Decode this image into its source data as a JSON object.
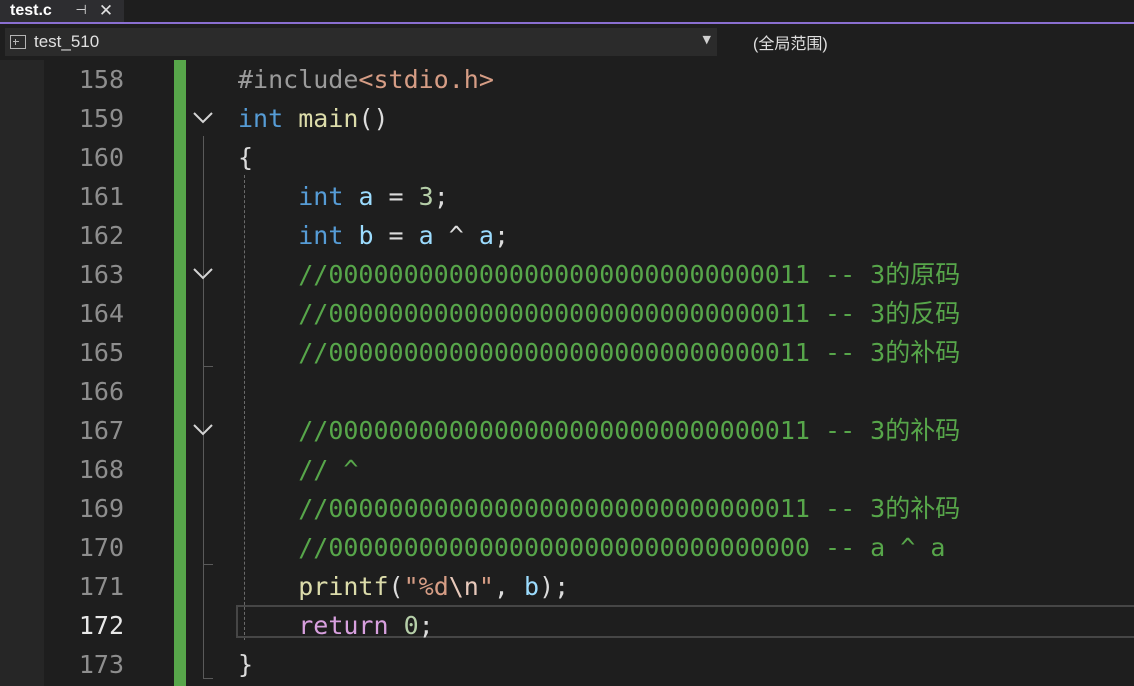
{
  "tab": {
    "title": "test.c",
    "pin_icon": "pin-icon",
    "close_icon": "close-icon"
  },
  "navbar": {
    "project": "test_510",
    "scope": "(全局范围)"
  },
  "colors": {
    "accent": "#8a6fd1",
    "change_bar": "#57a64a",
    "keyword": "#569cd6",
    "comment": "#57a64a",
    "function": "#dcdcaa",
    "variable": "#9cdcfe",
    "number": "#b5cea8",
    "string": "#d69d85",
    "return_kw": "#d8a0df"
  },
  "editor": {
    "current_line": "172",
    "lines": [
      {
        "num": "158",
        "tokens": [
          {
            "t": "pre",
            "v": "#include"
          },
          {
            "t": "inc",
            "v": "<stdio.h>"
          }
        ]
      },
      {
        "num": "159",
        "tokens": [
          {
            "t": "kw",
            "v": "int"
          },
          {
            "t": "op",
            "v": " "
          },
          {
            "t": "fn",
            "v": "main"
          },
          {
            "t": "op",
            "v": "()"
          }
        ]
      },
      {
        "num": "160",
        "tokens": [
          {
            "t": "op",
            "v": "{"
          }
        ]
      },
      {
        "num": "161",
        "tokens": [
          {
            "t": "op",
            "v": "    "
          },
          {
            "t": "kw",
            "v": "int"
          },
          {
            "t": "op",
            "v": " "
          },
          {
            "t": "var",
            "v": "a"
          },
          {
            "t": "op",
            "v": " = "
          },
          {
            "t": "num",
            "v": "3"
          },
          {
            "t": "op",
            "v": ";"
          }
        ]
      },
      {
        "num": "162",
        "tokens": [
          {
            "t": "op",
            "v": "    "
          },
          {
            "t": "kw",
            "v": "int"
          },
          {
            "t": "op",
            "v": " "
          },
          {
            "t": "var",
            "v": "b"
          },
          {
            "t": "op",
            "v": " = "
          },
          {
            "t": "var",
            "v": "a"
          },
          {
            "t": "op",
            "v": " ^ "
          },
          {
            "t": "var",
            "v": "a"
          },
          {
            "t": "op",
            "v": ";"
          }
        ]
      },
      {
        "num": "163",
        "tokens": [
          {
            "t": "op",
            "v": "    "
          },
          {
            "t": "cm",
            "v": "//00000000000000000000000000000011 -- 3的原码"
          }
        ]
      },
      {
        "num": "164",
        "tokens": [
          {
            "t": "op",
            "v": "    "
          },
          {
            "t": "cm",
            "v": "//00000000000000000000000000000011 -- 3的反码"
          }
        ]
      },
      {
        "num": "165",
        "tokens": [
          {
            "t": "op",
            "v": "    "
          },
          {
            "t": "cm",
            "v": "//00000000000000000000000000000011 -- 3的补码"
          }
        ]
      },
      {
        "num": "166",
        "tokens": []
      },
      {
        "num": "167",
        "tokens": [
          {
            "t": "op",
            "v": "    "
          },
          {
            "t": "cm",
            "v": "//00000000000000000000000000000011 -- 3的补码"
          }
        ]
      },
      {
        "num": "168",
        "tokens": [
          {
            "t": "op",
            "v": "    "
          },
          {
            "t": "cm",
            "v": "// ^"
          }
        ]
      },
      {
        "num": "169",
        "tokens": [
          {
            "t": "op",
            "v": "    "
          },
          {
            "t": "cm",
            "v": "//00000000000000000000000000000011 -- 3的补码"
          }
        ]
      },
      {
        "num": "170",
        "tokens": [
          {
            "t": "op",
            "v": "    "
          },
          {
            "t": "cm",
            "v": "//00000000000000000000000000000000 -- a ^ a"
          }
        ]
      },
      {
        "num": "171",
        "tokens": [
          {
            "t": "op",
            "v": "    "
          },
          {
            "t": "fn",
            "v": "printf"
          },
          {
            "t": "op",
            "v": "("
          },
          {
            "t": "str",
            "v": "\"%d"
          },
          {
            "t": "esc",
            "v": "\\n"
          },
          {
            "t": "str",
            "v": "\""
          },
          {
            "t": "op",
            "v": ", "
          },
          {
            "t": "var",
            "v": "b"
          },
          {
            "t": "op",
            "v": ");"
          }
        ]
      },
      {
        "num": "172",
        "tokens": [
          {
            "t": "op",
            "v": "    "
          },
          {
            "t": "ret",
            "v": "return"
          },
          {
            "t": "op",
            "v": " "
          },
          {
            "t": "num",
            "v": "0"
          },
          {
            "t": "op",
            "v": ";"
          }
        ]
      },
      {
        "num": "173",
        "tokens": [
          {
            "t": "op",
            "v": "}"
          }
        ]
      }
    ],
    "fold_markers": [
      "159",
      "163",
      "167"
    ]
  }
}
